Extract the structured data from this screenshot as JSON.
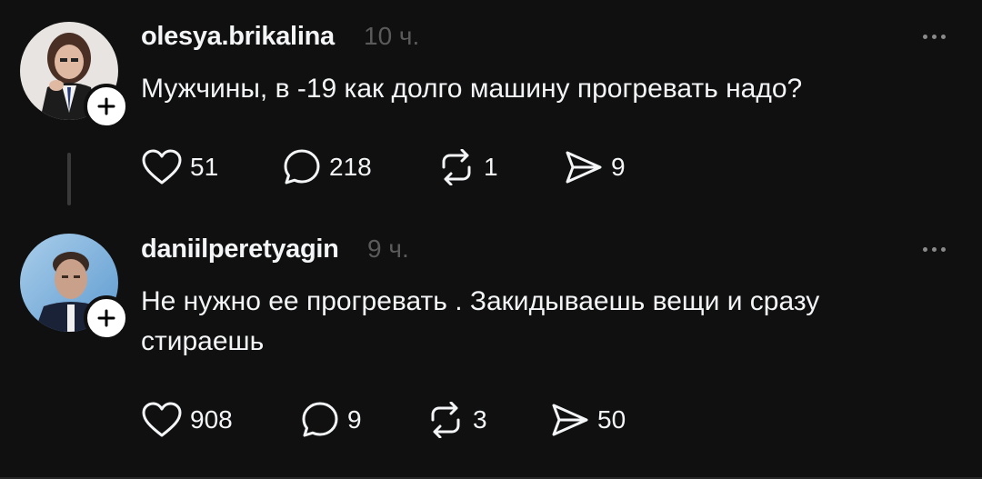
{
  "posts": [
    {
      "username": "olesya.brikalina",
      "time": "10 ч.",
      "text": "Мужчины, в -19 как долго машину прогревать надо?",
      "likes": "51",
      "comments": "218",
      "reposts": "1",
      "shares": "9"
    },
    {
      "username": "daniilperetyagin",
      "time": "9 ч.",
      "text": "Не нужно ее прогревать . Закидываешь вещи и сразу стираешь",
      "likes": "908",
      "comments": "9",
      "reposts": "3",
      "shares": "50"
    }
  ],
  "icons": {
    "like": "heart-icon",
    "comment": "comment-icon",
    "repost": "repost-icon",
    "share": "send-icon",
    "follow": "plus-icon",
    "more": "more-icon"
  },
  "colors": {
    "background": "#101010",
    "text": "#f3f5f7",
    "muted": "#5a5a5a"
  }
}
